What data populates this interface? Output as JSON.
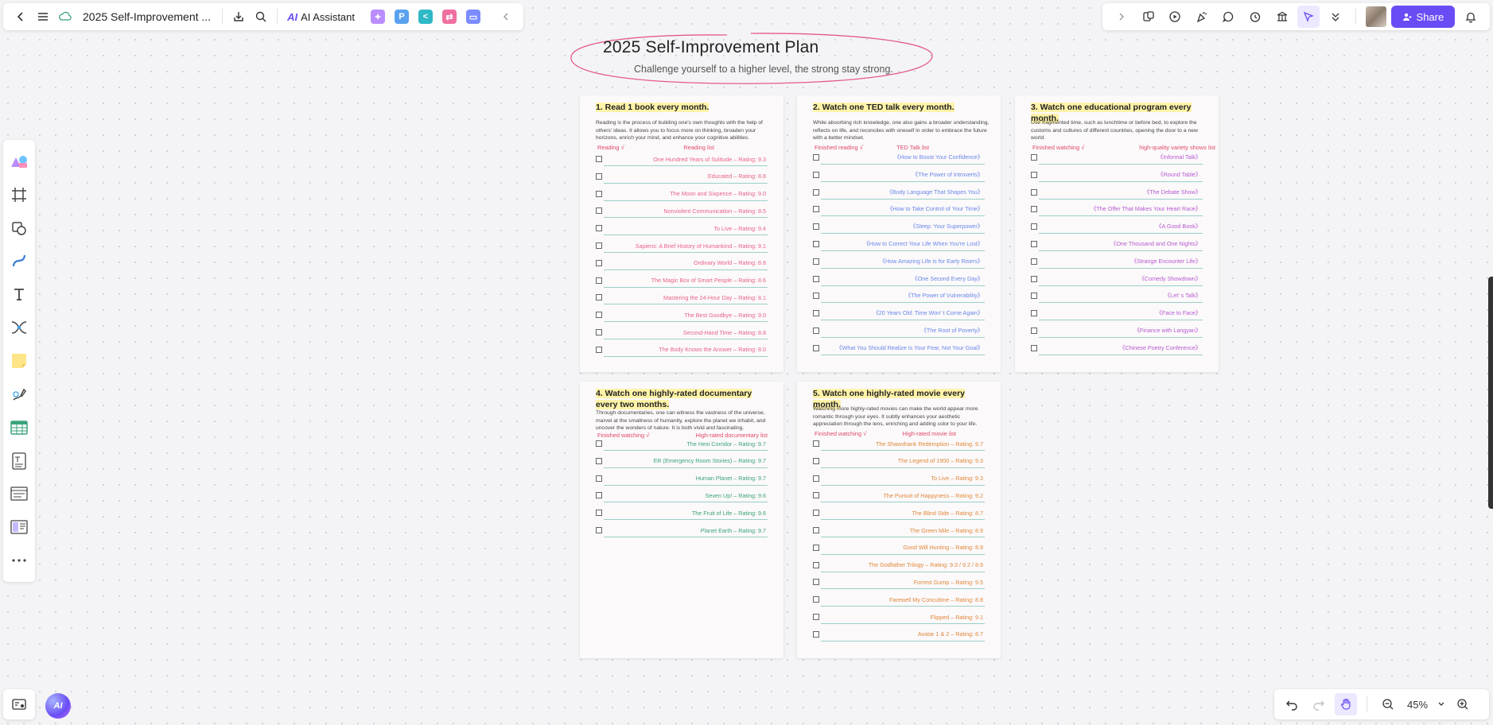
{
  "top_bar": {
    "doc_title": "2025 Self-Improvement ...",
    "ai_label": "AI Assistant",
    "ai_logo": "AI",
    "apps": [
      {
        "icon": "image-ai-icon",
        "color": "#b98cff",
        "glyph": "✦"
      },
      {
        "icon": "presentation-icon",
        "color": "#5aa2f0",
        "glyph": "P"
      },
      {
        "icon": "mindmap-icon",
        "color": "#2fb8c6",
        "glyph": "<"
      },
      {
        "icon": "flowchart-icon",
        "color": "#f06fa0",
        "glyph": "⇄"
      },
      {
        "icon": "chat-icon",
        "color": "#7a8cff",
        "glyph": "▭"
      }
    ]
  },
  "top_right": {
    "share_label": "Share"
  },
  "zoom": {
    "value": "45%"
  },
  "colors": {
    "accent": "#6a4cf5",
    "books": "#e8638a",
    "ted": "#6a86e8",
    "programs": "#b65ad0",
    "docs": "#3aa37a",
    "movies": "#e0883a",
    "highlight": "#fff3a8"
  },
  "canvas": {
    "title": "2025 Self-Improvement Plan",
    "subtitle": "Challenge yourself to a higher level, the strong stay strong."
  },
  "cards": [
    {
      "title": "1. Read 1 book every month.",
      "description": "Reading is the process of building one's own thoughts with the help of others' ideas. It allows you to focus more on thinking, broaden your horizons, enrich your mind, and enhance your cognitive abilities.",
      "label_left": "Reading √",
      "label_right": "Reading list",
      "items": [
        "One Hundred Years of Solitude – Rating: 9.3",
        "Educated – Rating: 8.8",
        "The Moon and Sixpence – Rating: 9.0",
        "Nonviolent Communication – Rating: 8.5",
        "To Live – Rating: 9.4",
        "Sapiens: A Brief History of Humankind – Rating: 9.1",
        "Ordinary World – Rating: 8.8",
        "The Magic Box of Smart People – Rating: 8.6",
        "Mastering the 24-Hour Day – Rating: 8.1",
        "The Best Goodbye – Rating: 9.0",
        "Second-Hand Time – Rating: 8.8",
        "The Body Knows the Answer – Rating: 8.0"
      ]
    },
    {
      "title": "2. Watch one TED talk every month.",
      "description": "While absorbing rich knowledge, one also gains a broader understanding, reflects on life, and reconciles with oneself in order to embrace the future with a better mindset.",
      "label_left": "Finished reading √",
      "label_right": "TED Talk list",
      "items": [
        "《How to Boost Your Confidence》",
        "《The Power of Introverts》",
        "《Body Language That Shapes You》",
        "《How to Take Control of Your Time》",
        "《Sleep: Your Superpower》",
        "《How to Correct Your Life When You're Lost》",
        "《How Amazing Life is for Early Risers》",
        "《One Second Every Day》",
        "《The Power of Vulnerability》",
        "《20 Years Old: Time Won' t Come Again》",
        "《The Root of Poverty》",
        "《What You Should Realize Is Your Fear, Not Your Goal》"
      ]
    },
    {
      "title": "3. Watch one educational program every month.",
      "description": "Use fragmented time, such as lunchtime or before bed, to explore the customs and cultures of different countries, opening the door to a new world.",
      "label_left": "Finished watching √",
      "label_right": "high-quality variety shows list",
      "items": [
        "《Informal Talk》",
        "《Round Table》",
        "《The Debate Show》",
        "《The Offer That Makes Your Heart Race》",
        "《A Good Book》",
        "《One Thousand and One Nights》",
        "《Strange Encounter Life》",
        "《Comedy Showdown》",
        "《Let' s Talk》",
        "《Face to Face》",
        "《Finance with Langyan》",
        "《Chinese Poetry Conference》"
      ]
    },
    {
      "title": "4. Watch one highly-rated documentary every two months.",
      "description": "Through documentaries, one can witness the vastness of the universe, marvel at the smallness of humanity, explore the planet we inhabit, and uncover the wonders of nature. It is both vivid and fascinating.",
      "label_left": "Finished watching √",
      "label_right": "High-rated documentary list",
      "items": [
        "The Hexi Corridor – Rating: 9.7",
        "ER (Emergency Room Stories) – Rating: 9.7",
        "Human Planet – Rating: 9.7",
        "Seven Up! – Rating: 9.6",
        "The Fruit of Life – Rating: 9.6",
        "Planet Earth – Rating: 9.7"
      ]
    },
    {
      "title": "5. Watch one highly-rated movie every month.",
      "description": "Watching more highly-rated movies can make the world appear more romantic through your eyes. It subtly enhances your aesthetic appreciation through the lens, enriching and adding color to your life.",
      "label_left": "Finished watching √",
      "label_right": "High-rated movie list",
      "items": [
        "The Shawshank Redemption – Rating: 9.7",
        "The Legend of 1900 – Rating: 9.3",
        "To Live – Rating: 9.3",
        "The Pursuit of Happyness – Rating: 9.2",
        "The Blind Side – Rating: 8.7",
        "The Green Mile – Rating: 8.9",
        "Good Will Hunting – Rating: 8.9",
        "The Godfather Trilogy – Rating: 9.3 / 9.2 / 8.9",
        "Forrest Gump – Rating: 9.5",
        "Farewell My Concubine – Rating: 8.8",
        "Flipped – Rating: 9.1",
        "Avatar 1 & 2 – Rating: 8.7"
      ]
    }
  ]
}
